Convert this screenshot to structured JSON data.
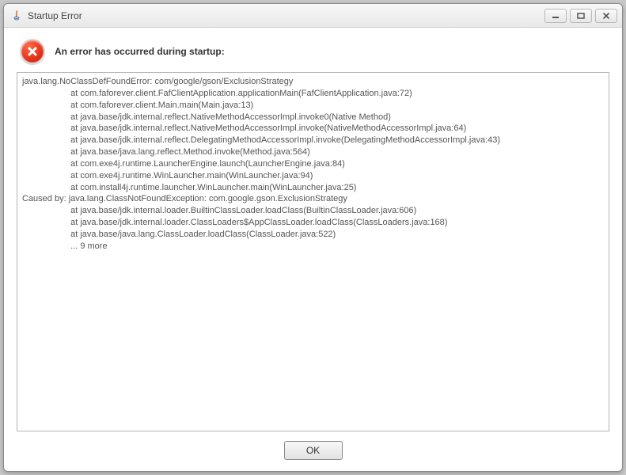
{
  "window": {
    "title": "Startup Error"
  },
  "header": {
    "message": "An error has occurred during startup:"
  },
  "trace": {
    "lines": [
      "java.lang.NoClassDefFoundError: com/google/gson/ExclusionStrategy",
      "                    at com.faforever.client.FafClientApplication.applicationMain(FafClientApplication.java:72)",
      "                    at com.faforever.client.Main.main(Main.java:13)",
      "                    at java.base/jdk.internal.reflect.NativeMethodAccessorImpl.invoke0(Native Method)",
      "                    at java.base/jdk.internal.reflect.NativeMethodAccessorImpl.invoke(NativeMethodAccessorImpl.java:64)",
      "                    at java.base/jdk.internal.reflect.DelegatingMethodAccessorImpl.invoke(DelegatingMethodAccessorImpl.java:43)",
      "                    at java.base/java.lang.reflect.Method.invoke(Method.java:564)",
      "                    at com.exe4j.runtime.LauncherEngine.launch(LauncherEngine.java:84)",
      "                    at com.exe4j.runtime.WinLauncher.main(WinLauncher.java:94)",
      "                    at com.install4j.runtime.launcher.WinLauncher.main(WinLauncher.java:25)",
      "Caused by: java.lang.ClassNotFoundException: com.google.gson.ExclusionStrategy",
      "                    at java.base/jdk.internal.loader.BuiltinClassLoader.loadClass(BuiltinClassLoader.java:606)",
      "                    at java.base/jdk.internal.loader.ClassLoaders$AppClassLoader.loadClass(ClassLoaders.java:168)",
      "                    at java.base/java.lang.ClassLoader.loadClass(ClassLoader.java:522)",
      "                    ... 9 more"
    ]
  },
  "footer": {
    "ok_label": "OK"
  }
}
